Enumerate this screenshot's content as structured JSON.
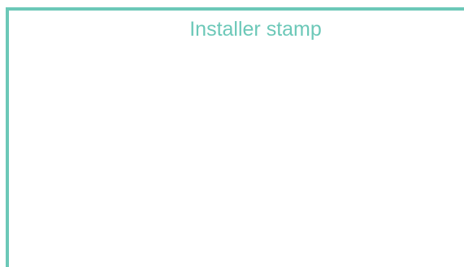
{
  "stamp": {
    "label": "Installer stamp",
    "accent_color": "#6cc8b8"
  }
}
